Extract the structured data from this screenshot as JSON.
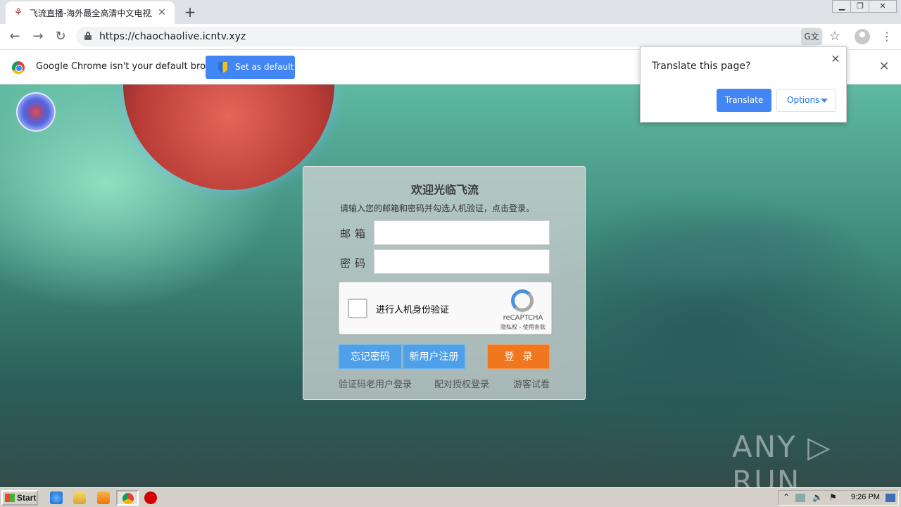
{
  "browser": {
    "tab_title": "飞流直播-海外最全高清中文电视直播",
    "tab_close": "✕",
    "new_tab": "+",
    "url": "https://chaochaolive.icntv.xyz",
    "back": "←",
    "forward": "→",
    "reload": "↻",
    "star": "☆",
    "menu": "⋮",
    "translate_glyph": "G文",
    "win_min": "▁",
    "win_max": "❐",
    "win_close": "✕"
  },
  "infobar": {
    "message": "Google Chrome isn't your default browser",
    "button": "Set as default",
    "close": "✕"
  },
  "translate_bubble": {
    "title": "Translate this page?",
    "close": "✕",
    "translate_button": "Translate",
    "options_button": "Options"
  },
  "login": {
    "title": "欢迎光临飞流",
    "subtitle": "请输入您的邮箱和密码并勾选人机验证，点击登录。",
    "email_label": "邮箱",
    "password_label": "密码",
    "email_value": "",
    "password_value": "",
    "captcha_label": "进行人机身份验证",
    "recaptcha_name": "reCAPTCHA",
    "recaptcha_links": "隐私权 - 使用条款",
    "forgot_button": "忘记密码",
    "register_button": "新用户注册",
    "login_button": "登录",
    "link_code_login": "验证码老用户登录",
    "link_auth_login": "配对授权登录",
    "link_guest": "游客试看"
  },
  "watermark": "ANY ▷ RUN",
  "taskbar": {
    "start": "Start",
    "clock": "9:26 PM"
  },
  "colors": {
    "accent_blue": "#4285f4",
    "login_orange": "#f0771e",
    "button_blue": "#4ea0e8"
  }
}
